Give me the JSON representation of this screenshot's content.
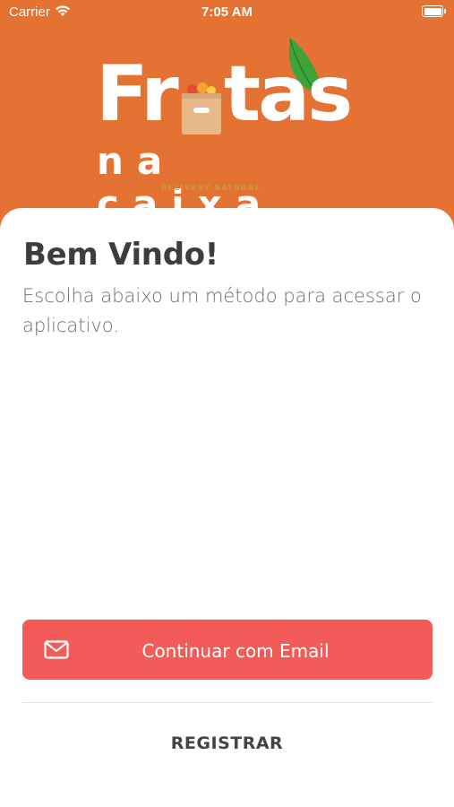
{
  "status_bar": {
    "carrier": "Carrier",
    "time": "7:05 AM",
    "wifi_icon": "wifi-icon",
    "battery_icon": "battery-icon"
  },
  "logo": {
    "first_letter": "Fr",
    "rest": "tas",
    "line2": "na caixa",
    "tagline": "DELIVERY NATURAL",
    "box_icon": "fruit-box-icon",
    "leaf_icon": "leaf-icon"
  },
  "welcome": {
    "title": "Bem Vindo!",
    "subtitle": "Escolha abaixo um método para acessar o aplicativo."
  },
  "actions": {
    "email_button_label": "Continuar com Email",
    "email_icon": "envelope-icon",
    "register_label": "REGISTRAR"
  },
  "colors": {
    "header_background": "#E47233",
    "primary_button": "#F25B57",
    "leaf_green": "#3DA33A",
    "box_tan": "#E7B98A"
  }
}
